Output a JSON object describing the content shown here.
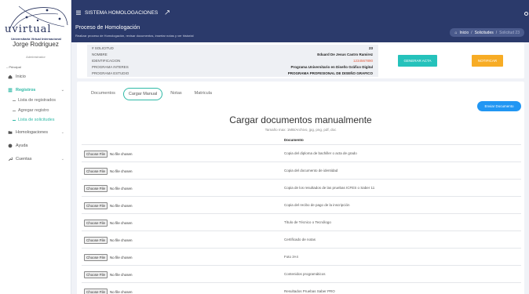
{
  "sidebar": {
    "logo_text": "uvirtual",
    "logo_subtitle": "Universitaria Virtual Internacional",
    "user_name": "Jorge Rodriguez",
    "user_role": "Administrador",
    "section_label": "– Principal",
    "nav": [
      {
        "label": "Inicio",
        "icon": "home-icon",
        "active": false
      },
      {
        "label": "Registros",
        "icon": "list-icon",
        "active": true
      },
      {
        "label": "Homologaciones",
        "icon": "folder-icon",
        "active": false
      },
      {
        "label": "Ayuda",
        "icon": "help-icon",
        "active": false
      },
      {
        "label": "Cuentas",
        "icon": "wrench-icon",
        "active": false
      }
    ],
    "sub_items": [
      {
        "label": "Lista de registrados",
        "active": false
      },
      {
        "label": "Agregar registro",
        "active": false
      },
      {
        "label": "Lista de solicitudes",
        "active": true
      }
    ]
  },
  "topbar": {
    "title": "SISTEMA HOMOLOGACIONES"
  },
  "header": {
    "title": "Proceso de Homologación",
    "subtitle": "Realizar proceso de Homologación, revisar documentos, insertar notas y ver historial",
    "breadcrumb": [
      "Inicio",
      "Solicitudes",
      "Solicitud 23"
    ]
  },
  "info": {
    "rows": [
      {
        "key": "# SOLICITUD",
        "value": "23"
      },
      {
        "key": "NOMBRE",
        "value": "Eduard De Jesus Castro Ramirez"
      },
      {
        "key": "IDENTIFICACION",
        "value": "1234567890"
      },
      {
        "key": "PROGRAMA INTERES",
        "value": "Programa Universitario en Diseño Gráfico Digital"
      },
      {
        "key": "PROGRAMA ESTUDIO",
        "value": "PROGRAMA PROFESIONAL DE DISEÑO GRAFICO"
      }
    ],
    "btn_acta": "GENERAR ACTA",
    "btn_notificar": "NOTIFICAR"
  },
  "main": {
    "tabs": [
      {
        "label": "Documentos",
        "active": false
      },
      {
        "label": "Cargar Manual",
        "active": true
      },
      {
        "label": "Notas",
        "active": false
      },
      {
        "label": "Matricula",
        "active": false
      }
    ],
    "btn_enviar": "Enviar Documento",
    "title": "Cargar documentos manualmente",
    "subtitle": "Tamaño max: 1MB/Archivo, jpg, png, pdf, doc",
    "doc_header": "Documento",
    "choose_label": "Choose File",
    "no_file": "No file chosen",
    "documents": [
      "Copia del diploma de bachiller o acta de grado",
      "Copia del documento de identidad",
      "Copia de los resultados de las pruebas ICFES o Saber 11",
      "Copia del recibo de pago de la inscripción",
      "Título de Técnico o Tecnólogo",
      "Certificado de notas",
      "Foto 3×4",
      "Contenidos programáticos",
      "Resultados Pruebas Saber PRO"
    ]
  }
}
